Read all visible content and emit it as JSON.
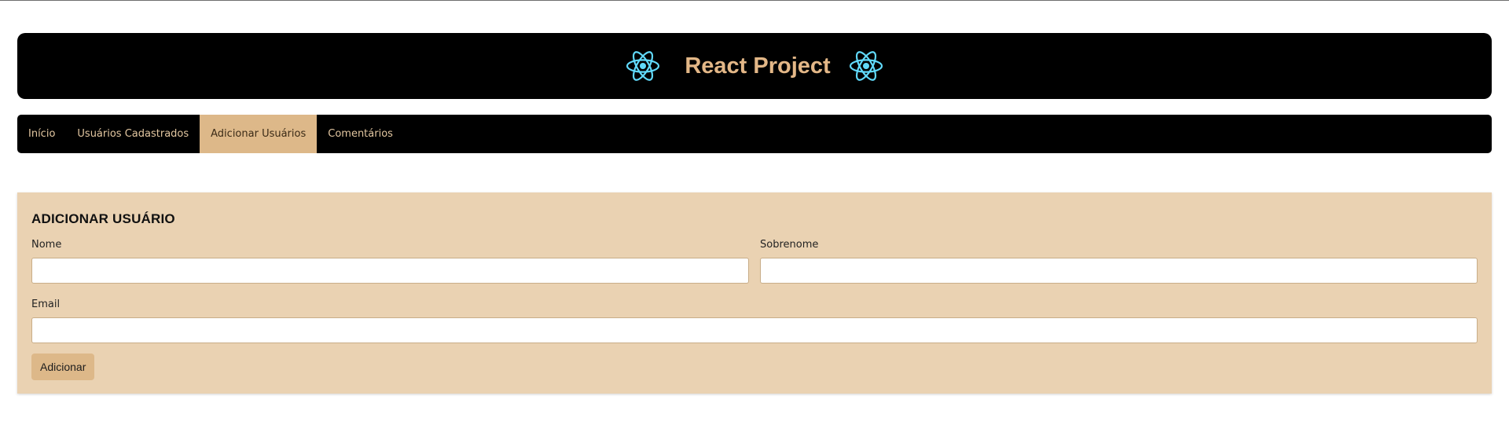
{
  "header": {
    "title": "React Project",
    "logo_icon": "react-atom-icon",
    "logo_color": "#61dafb",
    "title_color": "#e3b787"
  },
  "nav": {
    "items": [
      {
        "label": "Início",
        "active": false
      },
      {
        "label": "Usuários Cadastrados",
        "active": false
      },
      {
        "label": "Adicionar Usuários",
        "active": true
      },
      {
        "label": "Comentários",
        "active": false
      }
    ],
    "active_bg": "#ddb889"
  },
  "form": {
    "title": "ADICIONAR USUÁRIO",
    "fields": {
      "first_name": {
        "label": "Nome",
        "value": "",
        "placeholder": ""
      },
      "last_name": {
        "label": "Sobrenome",
        "value": "",
        "placeholder": ""
      },
      "email": {
        "label": "Email",
        "value": "",
        "placeholder": ""
      }
    },
    "submit_label": "Adicionar",
    "panel_bg": "#ead2b2"
  }
}
